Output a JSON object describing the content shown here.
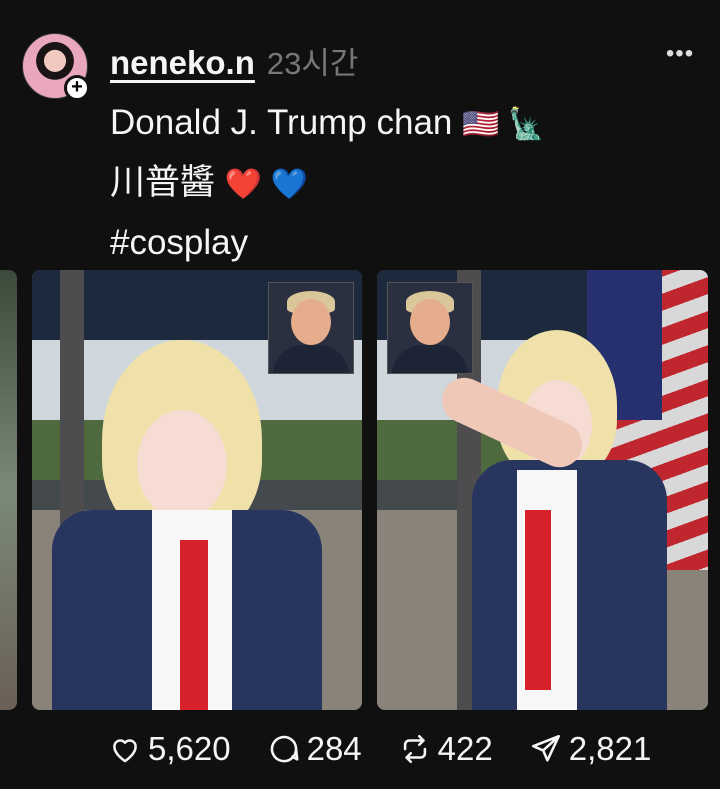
{
  "post": {
    "username": "neneko.n",
    "time": "23시간",
    "more_icon": "more-horizontal-icon",
    "caption": {
      "line1": "Donald J. Trump chan",
      "line1_emoji": "🇺🇸 🗽",
      "line2": "川普醬",
      "line2_emoji": "❤️ 💙",
      "line3": "#cosplay"
    }
  },
  "actions": {
    "likes": "5,620",
    "comments": "284",
    "reposts": "422",
    "shares": "2,821"
  },
  "colors": {
    "background": "#101010",
    "text": "#f3f5f7",
    "muted": "#777777"
  }
}
